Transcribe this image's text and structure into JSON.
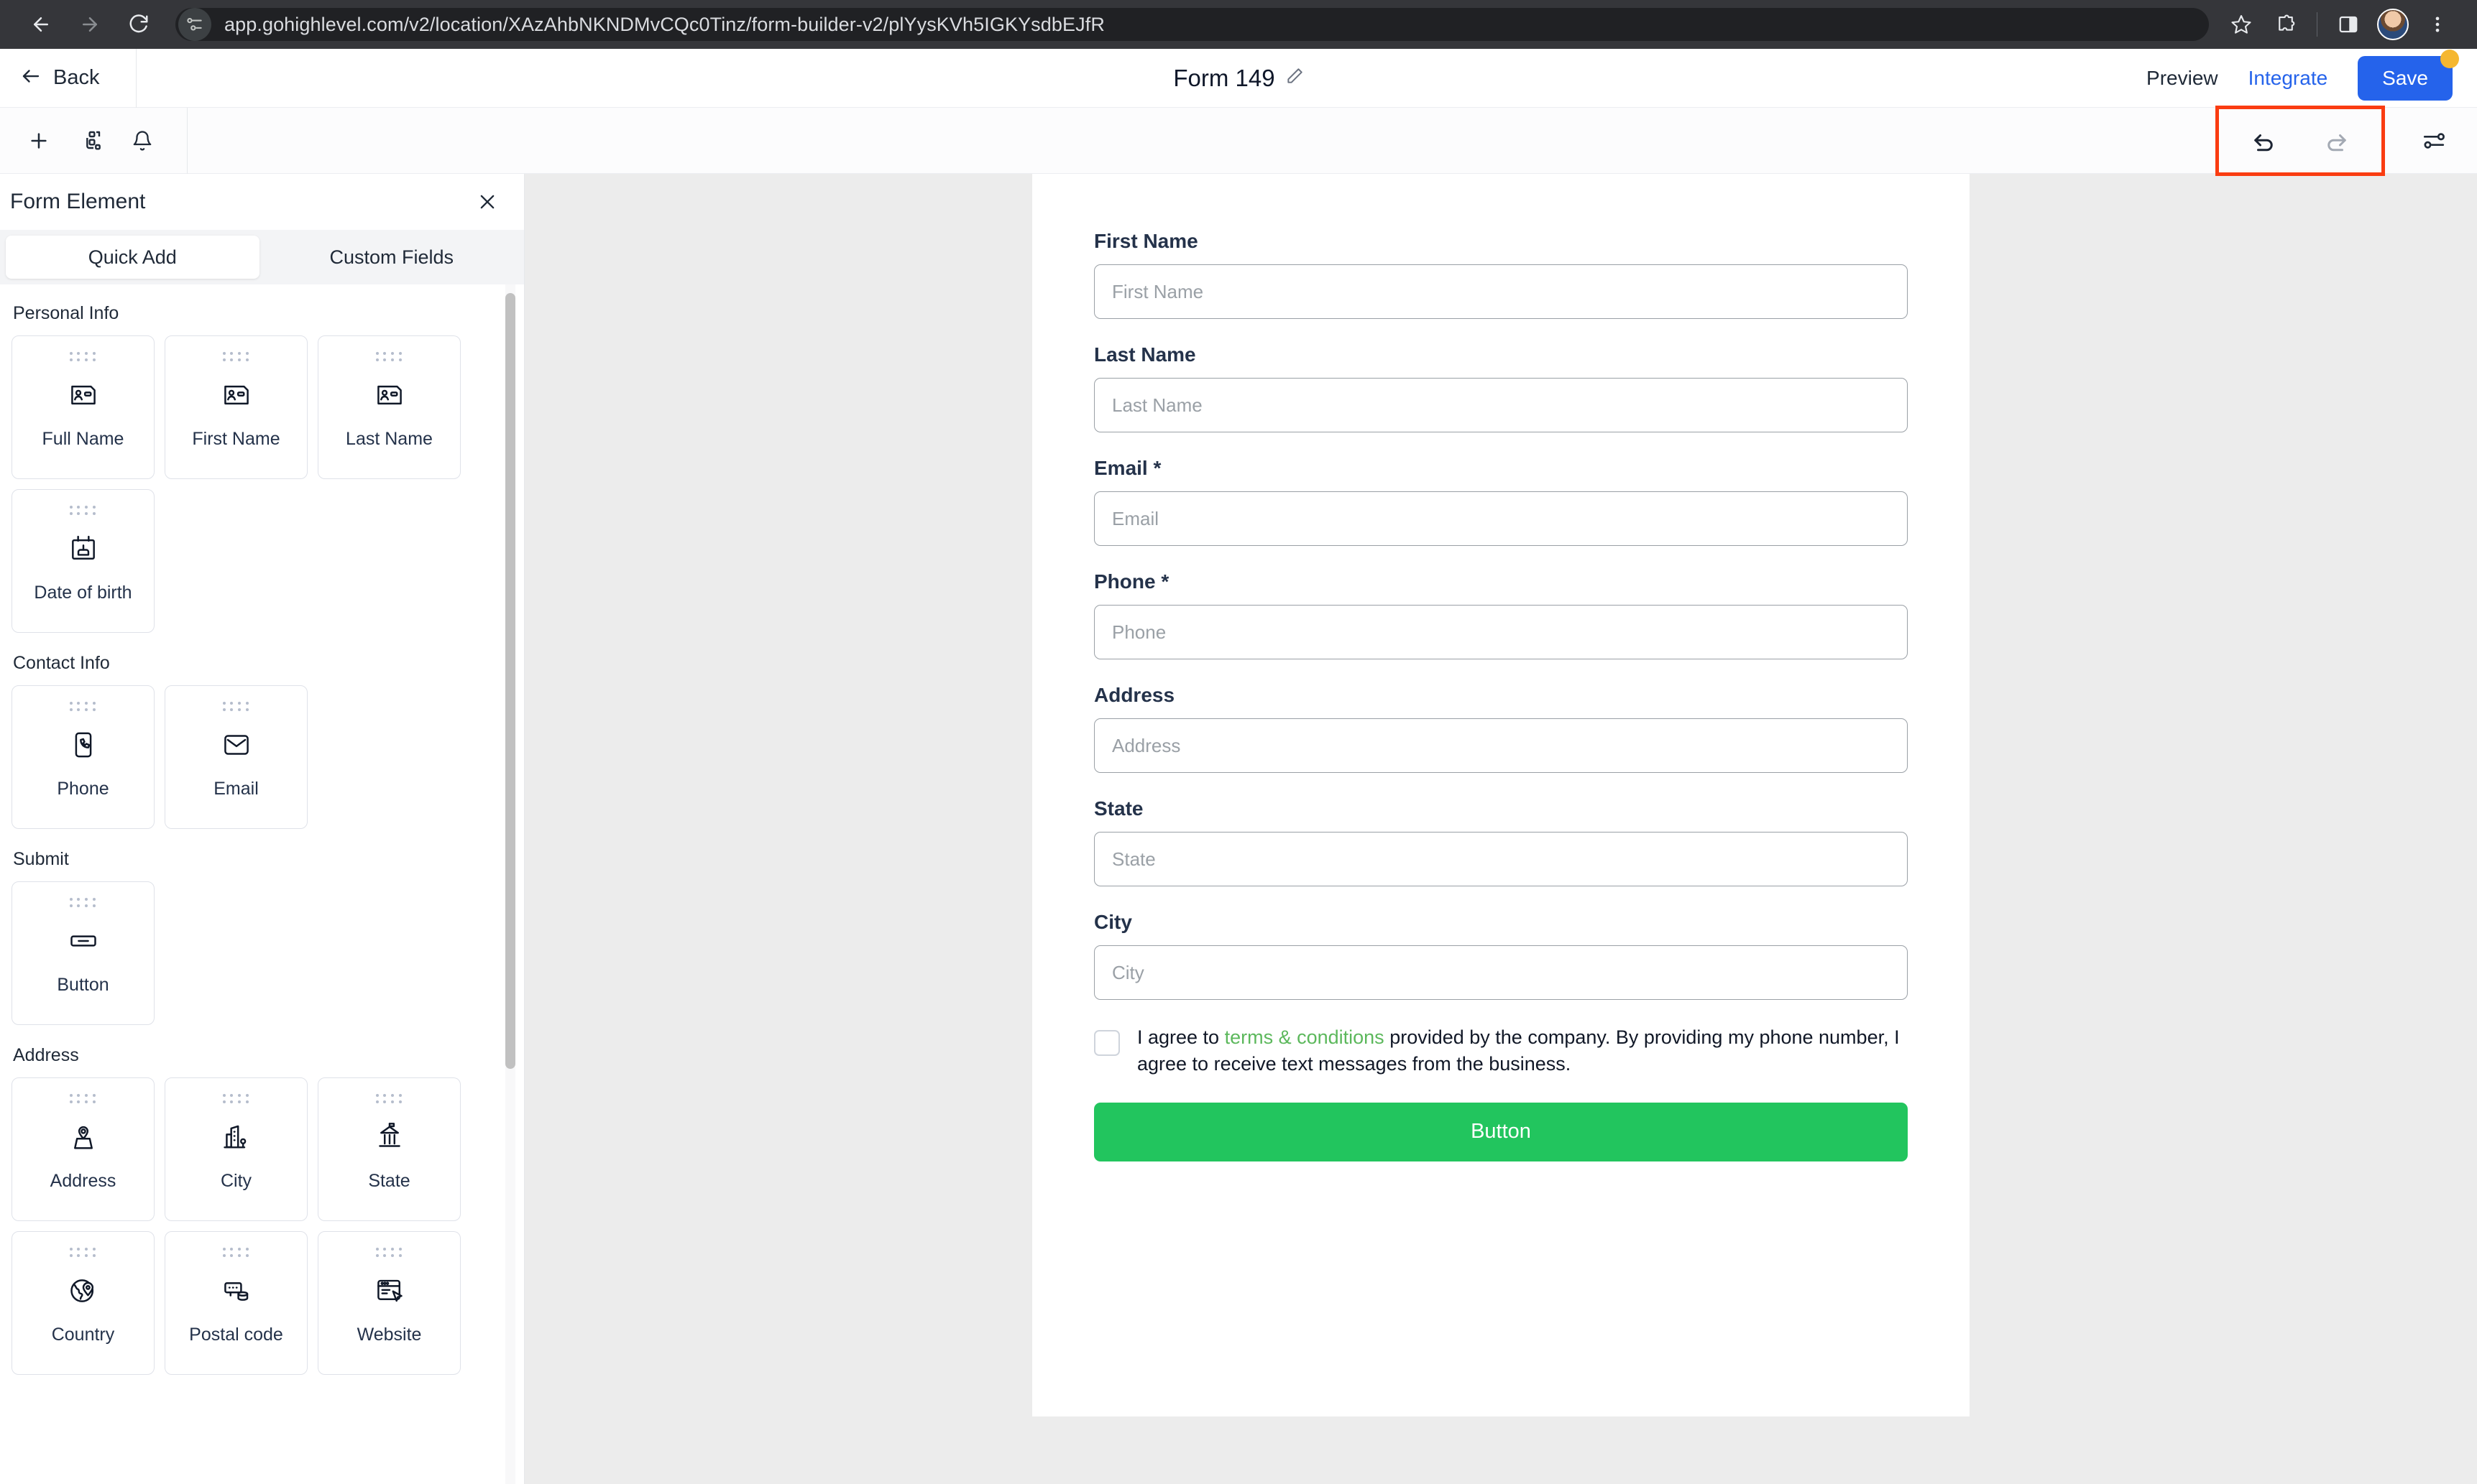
{
  "browser": {
    "url": "app.gohighlevel.com/v2/location/XAzAhbNKNDMvCQc0Tinz/form-builder-v2/plYysKVh5IGKYsdbEJfR",
    "back_icon": "back-arrow-icon",
    "forward_icon": "forward-arrow-icon",
    "reload_icon": "reload-icon",
    "site_info_icon": "site-settings-icon",
    "bookmark_icon": "star-icon",
    "extensions_icon": "puzzle-piece-icon",
    "side_panel_icon": "side-panel-icon",
    "profile_icon": "profile-avatar",
    "menu_icon": "three-dot-menu-icon"
  },
  "header": {
    "back_label": "Back",
    "title": "Form 149",
    "edit_icon": "pencil-edit-icon",
    "preview_label": "Preview",
    "integrate_label": "Integrate",
    "save_label": "Save",
    "unsaved_badge": "unsaved-changes-dot"
  },
  "toolbar": {
    "add_icon": "plus-icon",
    "layout_icon": "elements-layout-icon",
    "notify_icon": "bell-icon",
    "undo_icon": "undo-icon",
    "redo_icon": "redo-icon",
    "settings_icon": "sliders-settings-icon",
    "highlight_color": "#fa3c11"
  },
  "panel": {
    "title": "Form Element",
    "close_icon": "close-icon",
    "tabs": [
      {
        "label": "Quick Add",
        "active": true
      },
      {
        "label": "Custom Fields",
        "active": false
      }
    ],
    "sections": [
      {
        "title": "Personal Info",
        "items": [
          {
            "label": "Full Name",
            "icon": "contact-card-icon"
          },
          {
            "label": "First Name",
            "icon": "contact-card-icon"
          },
          {
            "label": "Last Name",
            "icon": "contact-card-icon"
          },
          {
            "label": "Date of birth",
            "icon": "birthday-calendar-icon"
          }
        ]
      },
      {
        "title": "Contact Info",
        "items": [
          {
            "label": "Phone",
            "icon": "phone-icon"
          },
          {
            "label": "Email",
            "icon": "envelope-icon"
          }
        ]
      },
      {
        "title": "Submit",
        "items": [
          {
            "label": "Button",
            "icon": "button-icon"
          }
        ]
      },
      {
        "title": "Address",
        "items": [
          {
            "label": "Address",
            "icon": "map-pin-icon"
          },
          {
            "label": "City",
            "icon": "city-buildings-icon"
          },
          {
            "label": "State",
            "icon": "government-building-icon"
          },
          {
            "label": "Country",
            "icon": "globe-icon"
          },
          {
            "label": "Postal code",
            "icon": "postal-code-icon"
          },
          {
            "label": "Website",
            "icon": "browser-window-icon"
          }
        ]
      }
    ]
  },
  "form": {
    "fields": [
      {
        "label": "First Name",
        "required": false,
        "placeholder": "First Name",
        "value": ""
      },
      {
        "label": "Last Name",
        "required": false,
        "placeholder": "Last Name",
        "value": ""
      },
      {
        "label": "Email *",
        "required": true,
        "placeholder": "Email",
        "value": ""
      },
      {
        "label": "Phone *",
        "required": true,
        "placeholder": "Phone",
        "value": ""
      },
      {
        "label": "Address",
        "required": false,
        "placeholder": "Address",
        "value": ""
      },
      {
        "label": "State",
        "required": false,
        "placeholder": "State",
        "value": ""
      },
      {
        "label": "City",
        "required": false,
        "placeholder": "City",
        "value": ""
      }
    ],
    "terms": {
      "prefix": "I agree to ",
      "link": "terms & conditions",
      "suffix": " provided by the company. By providing my phone number, I agree to receive text messages from the business.",
      "checked": false,
      "link_color": "#5cb85c"
    },
    "submit_label": "Button",
    "submit_color": "#22c55e"
  }
}
